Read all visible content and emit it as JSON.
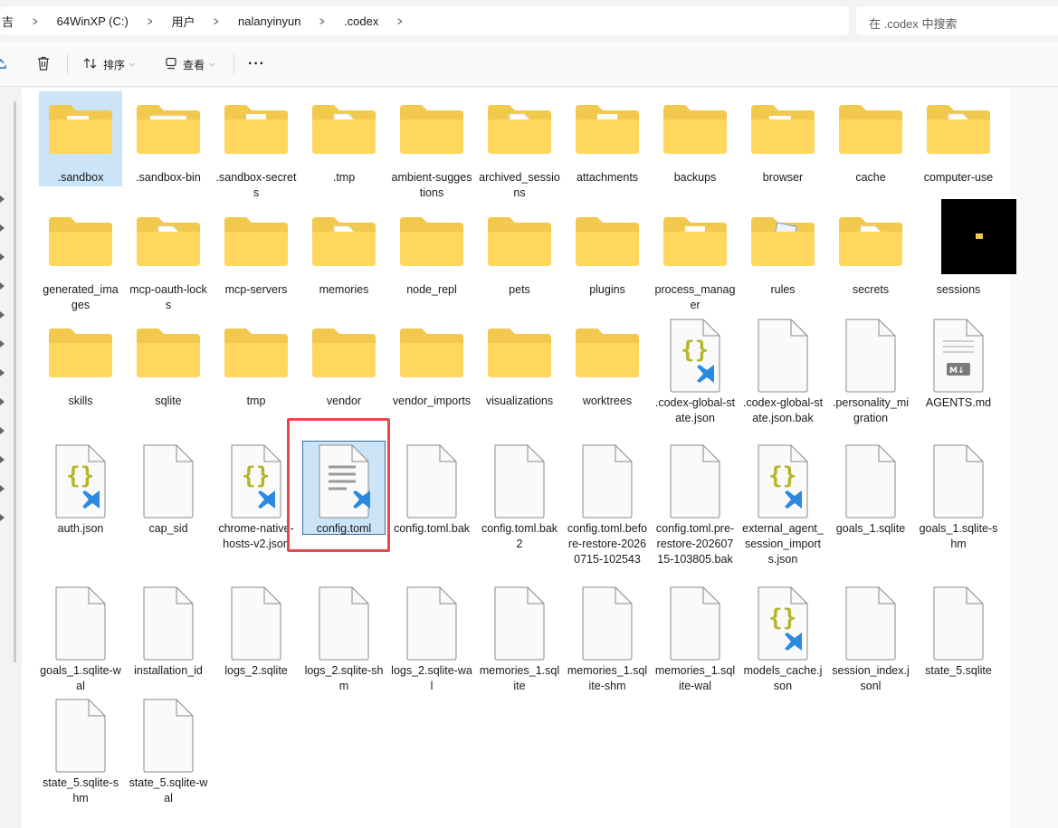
{
  "address": {
    "crumbs": [
      "吉",
      "64WinXP (C:)",
      "用户",
      "nalanyinyun",
      ".codex"
    ],
    "search_placeholder": "在 .codex 中搜索"
  },
  "toolbar": {
    "sort_label": "排序",
    "view_label": "查看",
    "more_label": "···"
  },
  "folders": [
    ".sandbox",
    ".sandbox-bin",
    ".sandbox-secrets",
    ".tmp",
    "ambient-suggestions",
    "archived_sessions",
    "attachments",
    "backups",
    "browser",
    "cache",
    "computer-use",
    "generated_images",
    "mcp-oauth-locks",
    "mcp-servers",
    "memories",
    "node_repl",
    "pets",
    "plugins",
    "process_manager",
    "rules",
    "secrets",
    "sessions",
    "skills",
    "sqlite",
    "tmp",
    "vendor",
    "vendor_imports",
    "visualizations",
    "worktrees"
  ],
  "files": [
    ".codex-global-state.json",
    ".codex-global-state.json.bak",
    ".personality_migration",
    "AGENTS.md",
    "auth.json",
    "cap_sid",
    "chrome-native-hosts-v2.json",
    "config.toml",
    "config.toml.bak",
    "config.toml.bak2",
    "config.toml.before-restore-20260715-102543",
    "config.toml.pre-restore-20260715-103805.bak",
    "external_agent_session_imports.json",
    "goals_1.sqlite",
    "goals_1.sqlite-shm",
    "goals_1.sqlite-wal",
    "installation_id",
    "logs_2.sqlite",
    "logs_2.sqlite-shm",
    "logs_2.sqlite-wal",
    "memories_1.sqlite",
    "memories_1.sqlite-shm",
    "memories_1.sqlite-wal",
    "models_cache.json",
    "session_index.jsonl",
    "state_5.sqlite",
    "state_5.sqlite-shm",
    "state_5.sqlite-wal"
  ],
  "selected_item": "config.toml",
  "colors": {
    "folder_back": "#f2c94c",
    "folder_front": "#ffd75e",
    "selection": "#cce4f7",
    "highlight": "#e5484d",
    "vscode_blue": "#2a8ae2",
    "json_brace": "#b5b52a"
  }
}
